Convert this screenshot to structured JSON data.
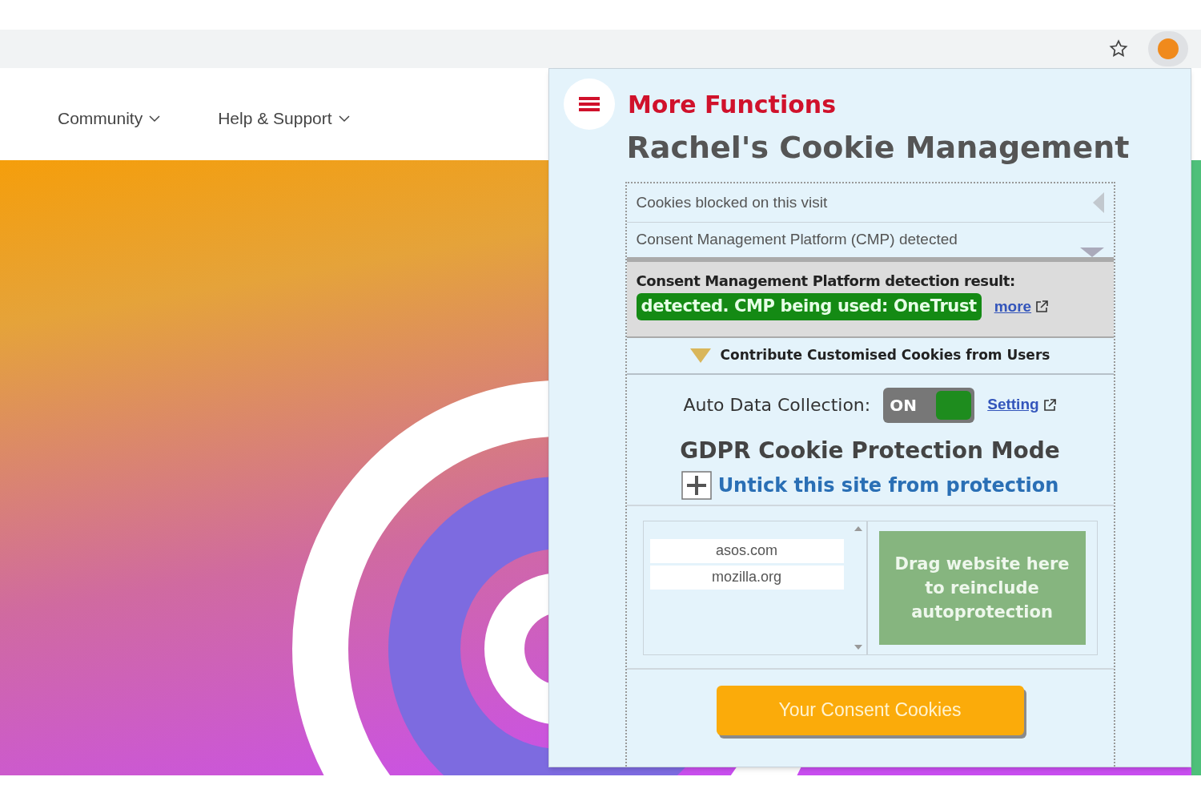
{
  "nav": [
    {
      "label": "Community"
    },
    {
      "label": "Help & Support"
    }
  ],
  "popup": {
    "menu_label": "More Functions",
    "title": "Rachel's Cookie Management",
    "sections": [
      {
        "label": "Cookies blocked on this visit",
        "expanded": false
      },
      {
        "label": "Consent Management Platform (CMP) detected",
        "expanded": true
      }
    ],
    "detection": {
      "heading": "Consent Management Platform detection result:",
      "result": "detected. CMP being used: OneTrust",
      "link": "more"
    },
    "contribute": "Contribute Customised Cookies from Users",
    "auto_collection": {
      "label": "Auto Data Collection:",
      "toggle_text": "ON",
      "on": true,
      "link": "Setting"
    },
    "mode_title": "GDPR Cookie Protection Mode",
    "untick_label": "Untick this site from protection",
    "excluded_sites": [
      "asos.com",
      "mozilla.org"
    ],
    "drop_zone": "Drag website here to reinclude autoprotection",
    "consent_button": "Your Consent Cookies"
  }
}
